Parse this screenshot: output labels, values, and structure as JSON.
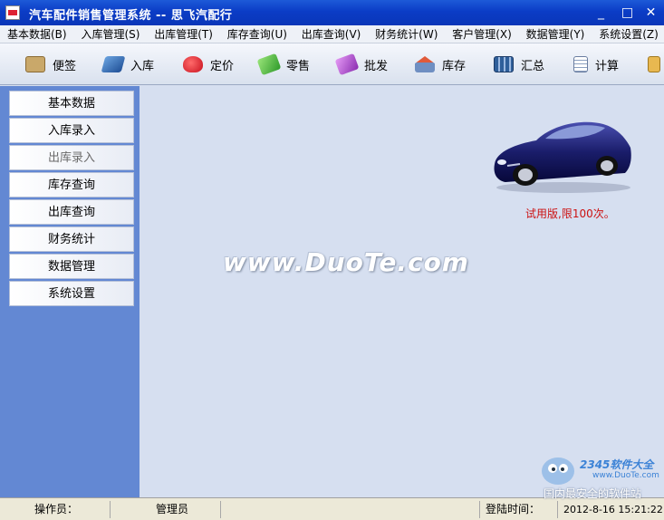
{
  "window": {
    "title": "汽车配件销售管理系统  --  思飞汽配行",
    "minimize": "_",
    "maximize": "□",
    "close": "✕"
  },
  "menu": [
    "基本数据(B)",
    "入库管理(S)",
    "出库管理(T)",
    "库存查询(U)",
    "出库查询(V)",
    "财务统计(W)",
    "客户管理(X)",
    "数据管理(Y)",
    "系统设置(Z)"
  ],
  "toolbar": [
    {
      "label": "便签",
      "icon": "note-icon",
      "color": "#b08a4c"
    },
    {
      "label": "入库",
      "icon": "book-icon",
      "color": "#2c6fb8"
    },
    {
      "label": "定价",
      "icon": "heart-icon",
      "color": "#d81e2c"
    },
    {
      "label": "零售",
      "icon": "diamond-green-icon",
      "color": "#3cb043"
    },
    {
      "label": "批发",
      "icon": "diamond-purple-icon",
      "color": "#a43cc8"
    },
    {
      "label": "库存",
      "icon": "house-icon",
      "color": "#4a6fa5"
    },
    {
      "label": "汇总",
      "icon": "calculator-icon",
      "color": "#2f5f9a"
    },
    {
      "label": "计算",
      "icon": "calc-sheet-icon",
      "color": "#8ca0c0"
    }
  ],
  "sidebar": [
    {
      "label": "基本数据",
      "dim": false
    },
    {
      "label": "入库录入",
      "dim": false
    },
    {
      "label": "出库录入",
      "dim": true
    },
    {
      "label": "库存查询",
      "dim": false
    },
    {
      "label": "出库查询",
      "dim": false
    },
    {
      "label": "财务统计",
      "dim": false
    },
    {
      "label": "数据管理",
      "dim": false
    },
    {
      "label": "系统设置",
      "dim": false
    }
  ],
  "main": {
    "trial_notice": "试用版,限100次。",
    "watermark": "www.DuoTe.com"
  },
  "status": {
    "operator_label": "操作员：",
    "operator_value": "管理员",
    "login_label": "登陆时间：",
    "login_value": "2012-8-16 15:21:22"
  },
  "badge": {
    "brand": "2345软件大全",
    "site": "www.DuoTe.com",
    "slogan": "国内最安全的软件站"
  },
  "colors": {
    "titlebar": "#0b3cc6",
    "sidebar": "#6388d3",
    "main_bg": "#d6dff0",
    "trial_text": "#cc1111"
  }
}
